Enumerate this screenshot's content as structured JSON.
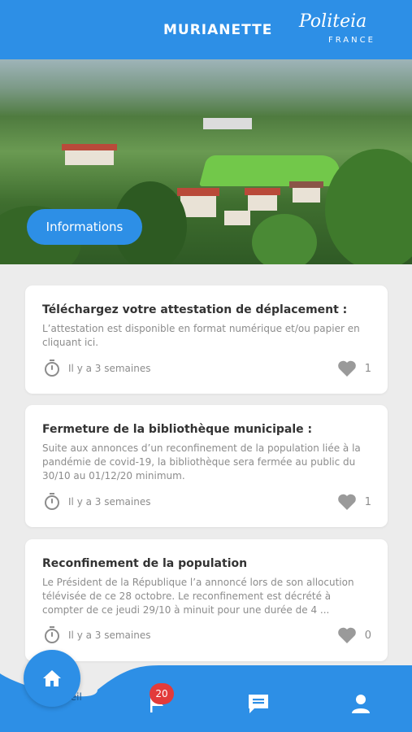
{
  "header": {
    "title": "MURIANETTE",
    "logo_brand": "Politeia",
    "logo_sub": "FRANCE"
  },
  "hero": {
    "button_label": "Informations"
  },
  "news": [
    {
      "title": "Téléchargez votre attestation de déplacement :",
      "description": "L’attestation est disponible en format numérique et/ou papier en cliquant ici.",
      "time": "Il y a 3 semaines",
      "likes": "1"
    },
    {
      "title": "Fermeture de la bibliothèque municipale :",
      "description": "Suite aux annonces d’un reconfinement de la population liée à la pandémie de covid-19, la bibliothèque sera fermée au public du 30/10 au 01/12/20 minimum.",
      "time": "Il y a 3 semaines",
      "likes": "1"
    },
    {
      "title": "Reconfinement de la population",
      "description": "Le Président de la République l’a annoncé lors de son allocution télévisée de ce 28 octobre.  Le reconfinement est décrété à compter de ce jeudi 29/10 à minuit pour une durée de 4 ...",
      "time": "Il y a 3 semaines",
      "likes": "0"
    }
  ],
  "nav": {
    "home_label": "Accueil",
    "alerts_badge": "20",
    "items": [
      "home-icon",
      "flag-icon",
      "chat-icon",
      "user-icon"
    ]
  },
  "colors": {
    "primary": "#2d8fe6",
    "badge": "#e23b3b",
    "card": "#ffffff",
    "background": "#ececec"
  }
}
